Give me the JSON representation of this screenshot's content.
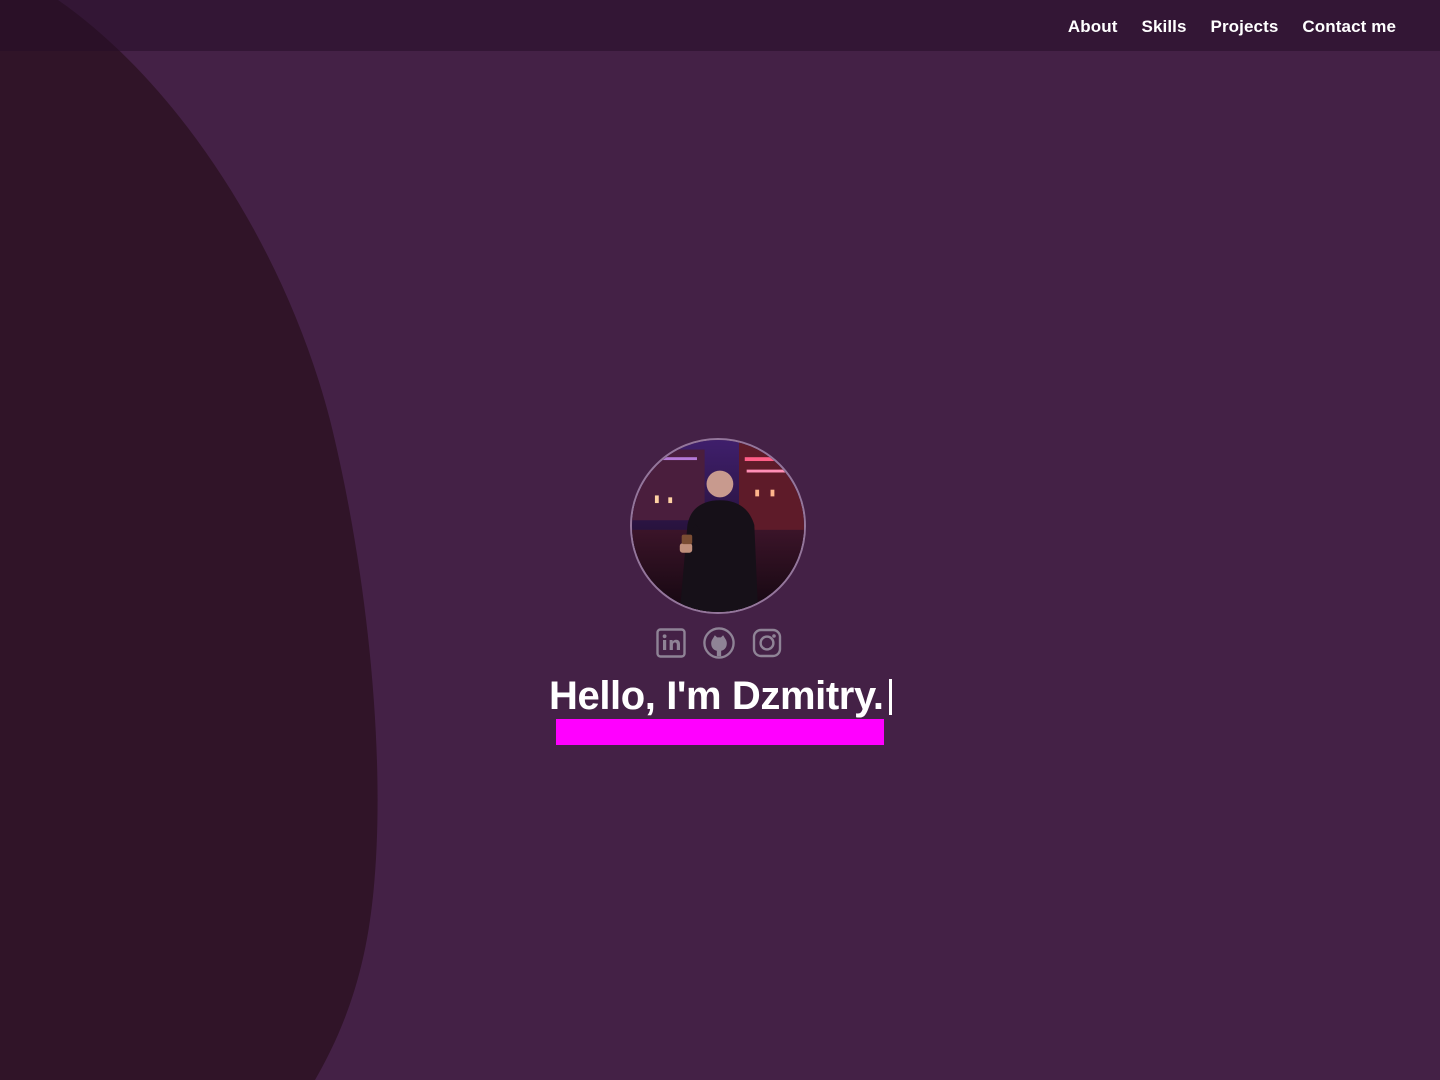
{
  "header": {
    "nav": [
      "About",
      "Skills",
      "Projects",
      "Contact me"
    ]
  },
  "hero": {
    "avatar": {
      "icon": "profile-photo"
    },
    "social": [
      {
        "icon": "linkedin-icon"
      },
      {
        "icon": "github-icon"
      },
      {
        "icon": "instagram-icon"
      }
    ],
    "title": "Hello, I'm Dzmitry."
  },
  "colors": {
    "background": "#442146",
    "left_blob": "#301428",
    "header": "#2d1832",
    "accent": "#ff00ff",
    "text": "#ffffff",
    "icon_gray": "#8f8396"
  }
}
